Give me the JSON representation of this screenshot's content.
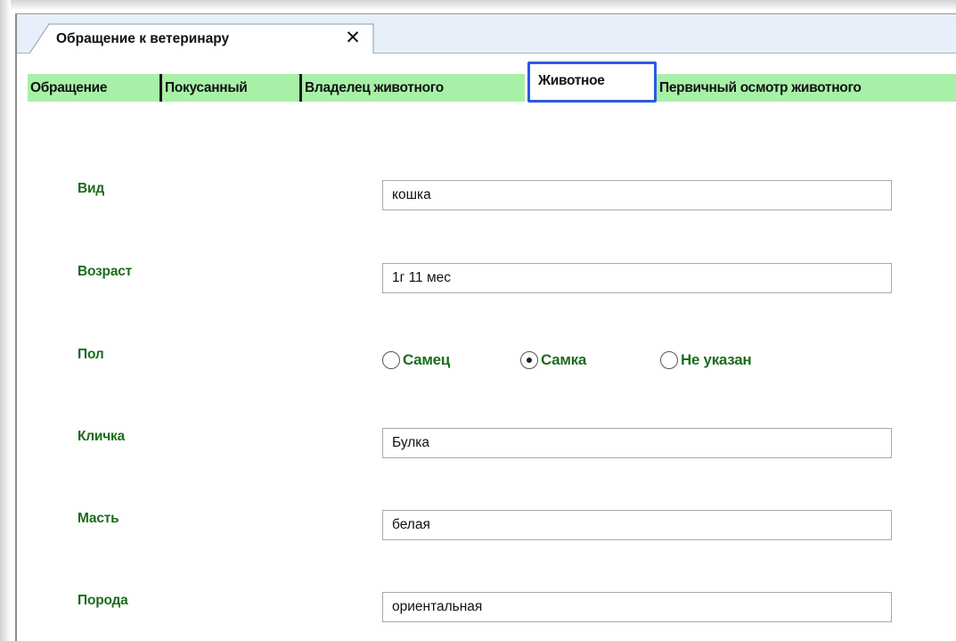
{
  "document_tab": {
    "title": "Обращение к ветеринару",
    "close_glyph": "✕"
  },
  "subtabs": [
    {
      "label": "Обращение",
      "active": false
    },
    {
      "label": "Покусанный",
      "active": false
    },
    {
      "label": "Владелец животного",
      "active": false
    },
    {
      "label": "Животное",
      "active": true
    },
    {
      "label": "Первичный осмотр животного",
      "active": false
    }
  ],
  "form": {
    "species": {
      "label": "Вид",
      "value": "кошка"
    },
    "age": {
      "label": "Возраст",
      "value": "1г 11 мес"
    },
    "sex": {
      "label": "Пол",
      "options": [
        "Самец",
        "Самка",
        "Не указан"
      ],
      "selected": "Самка"
    },
    "name": {
      "label": "Кличка",
      "value": "Булка"
    },
    "color": {
      "label": "Масть",
      "value": "белая"
    },
    "breed": {
      "label": "Порода",
      "value": "ориентальная"
    }
  },
  "colors": {
    "label_green": "#1e6b1e",
    "subtab_green": "#a8f0a8",
    "active_tab_border": "#2a5ae3",
    "tabstrip_bg": "#e7f0fa"
  },
  "icons": {
    "close": "close-icon",
    "radio": "radio-button"
  }
}
